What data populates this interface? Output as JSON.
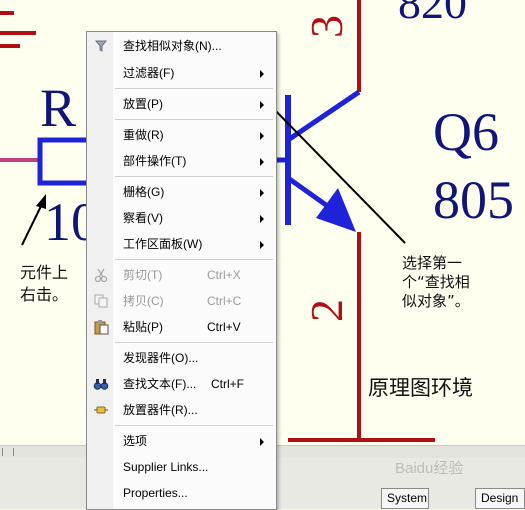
{
  "schematic": {
    "res_ref": "R",
    "res_value": "10",
    "pin3": "3",
    "pin2": "2",
    "q_value": "820",
    "q_ref": "Q6",
    "q_part": "805",
    "colors": {
      "wire": "#b10d14",
      "component": "#1e22d8",
      "label_text": "#0f1677",
      "canvas_bg": "#fffff0"
    }
  },
  "annotations": {
    "right_click_note": [
      "元件上",
      "右击。"
    ],
    "select_note": [
      "选择第一",
      "个“查找相",
      "似对象”。"
    ],
    "environment_label": "原理图环境"
  },
  "context_menu": {
    "items": [
      {
        "label": "查找相似对象(N)...",
        "shortcut": "",
        "submenu": false,
        "disabled": false,
        "icon": "funnel-icon"
      },
      {
        "label": "过滤器(F)",
        "shortcut": "",
        "submenu": true,
        "disabled": false,
        "icon": ""
      },
      {
        "label": "放置(P)",
        "shortcut": "",
        "submenu": true,
        "disabled": false,
        "icon": ""
      },
      {
        "label": "重做(R)",
        "shortcut": "",
        "submenu": true,
        "disabled": false,
        "icon": ""
      },
      {
        "label": "部件操作(T)",
        "shortcut": "",
        "submenu": true,
        "disabled": false,
        "icon": ""
      },
      {
        "label": "栅格(G)",
        "shortcut": "",
        "submenu": true,
        "disabled": false,
        "icon": ""
      },
      {
        "label": "察看(V)",
        "shortcut": "",
        "submenu": true,
        "disabled": false,
        "icon": ""
      },
      {
        "label": "工作区面板(W)",
        "shortcut": "",
        "submenu": true,
        "disabled": false,
        "icon": ""
      },
      {
        "label": "剪切(T)",
        "shortcut": "Ctrl+X",
        "submenu": false,
        "disabled": true,
        "icon": "scissors-icon"
      },
      {
        "label": "拷贝(C)",
        "shortcut": "Ctrl+C",
        "submenu": false,
        "disabled": true,
        "icon": "copy-icon"
      },
      {
        "label": "粘贴(P)",
        "shortcut": "Ctrl+V",
        "submenu": false,
        "disabled": false,
        "icon": "paste-icon"
      },
      {
        "label": "发现器件(O)...",
        "shortcut": "",
        "submenu": false,
        "disabled": false,
        "icon": ""
      },
      {
        "label": "查找文本(F)...",
        "shortcut": "Ctrl+F",
        "submenu": false,
        "disabled": false,
        "icon": "binoculars-icon"
      },
      {
        "label": "放置器件(R)...",
        "shortcut": "",
        "submenu": false,
        "disabled": false,
        "icon": "place-part-icon"
      },
      {
        "label": "选项",
        "shortcut": "",
        "submenu": true,
        "disabled": false,
        "icon": ""
      },
      {
        "label": "Supplier Links...",
        "shortcut": "",
        "submenu": false,
        "disabled": false,
        "icon": ""
      },
      {
        "label": "Properties...",
        "shortcut": "",
        "submenu": false,
        "disabled": false,
        "icon": ""
      }
    ]
  },
  "panel_tabs": [
    "System",
    "Design"
  ],
  "watermark": "Baidu经验"
}
